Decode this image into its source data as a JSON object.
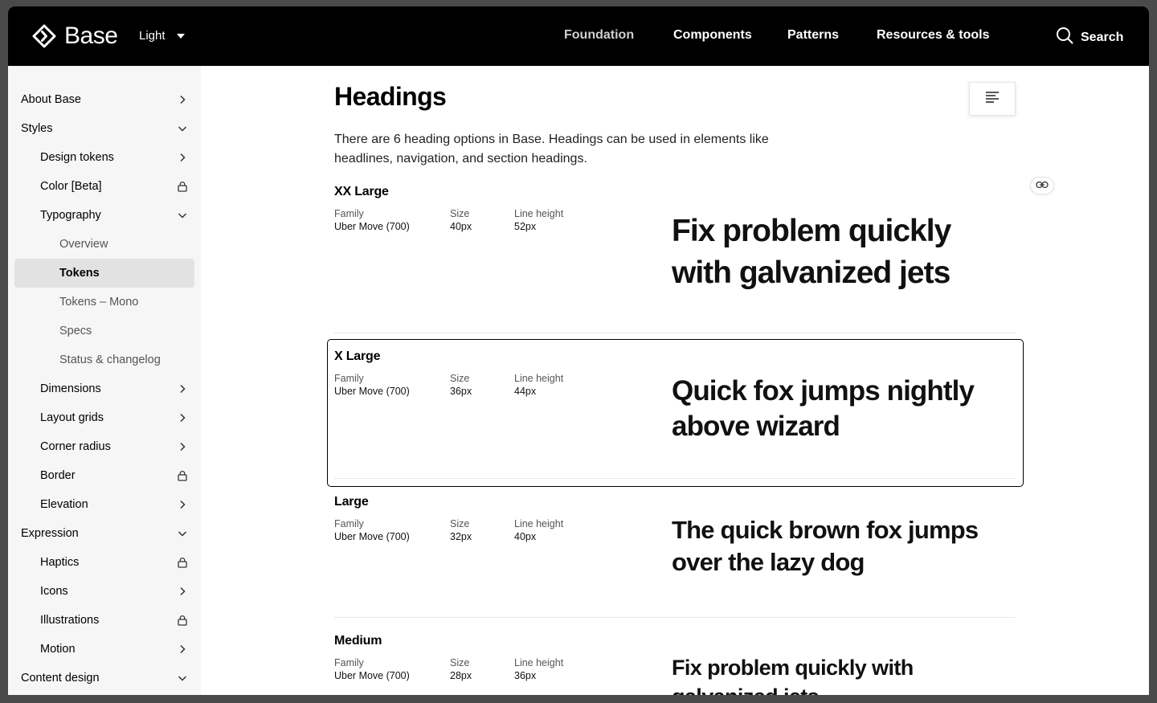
{
  "header": {
    "brand": "Base",
    "theme": "Light",
    "nav": [
      {
        "label": "Foundation",
        "active": true
      },
      {
        "label": "Components",
        "active": false
      },
      {
        "label": "Patterns",
        "active": false
      },
      {
        "label": "Resources & tools",
        "active": false
      }
    ],
    "search_label": "Search"
  },
  "sidebar": {
    "items": [
      {
        "label": "About Base",
        "icon": "chevron-right-icon"
      },
      {
        "label": "Styles",
        "icon": "chevron-down-icon"
      },
      {
        "label": "Design tokens",
        "icon": "chevron-right-icon"
      },
      {
        "label": "Color [Beta]",
        "icon": "lock-icon"
      },
      {
        "label": "Typography",
        "icon": "chevron-down-icon"
      },
      {
        "label": "Overview",
        "icon": ""
      },
      {
        "label": "Tokens",
        "icon": "",
        "selected": true
      },
      {
        "label": "Tokens – Mono",
        "icon": ""
      },
      {
        "label": "Specs",
        "icon": ""
      },
      {
        "label": "Status & changelog",
        "icon": ""
      },
      {
        "label": "Dimensions",
        "icon": "chevron-right-icon"
      },
      {
        "label": "Layout grids",
        "icon": "chevron-right-icon"
      },
      {
        "label": "Corner radius",
        "icon": "chevron-right-icon"
      },
      {
        "label": "Border",
        "icon": "lock-icon"
      },
      {
        "label": "Elevation",
        "icon": "chevron-right-icon"
      },
      {
        "label": "Expression",
        "icon": "chevron-down-icon"
      },
      {
        "label": "Haptics",
        "icon": "lock-icon"
      },
      {
        "label": "Icons",
        "icon": "chevron-right-icon"
      },
      {
        "label": "Illustrations",
        "icon": "lock-icon"
      },
      {
        "label": "Motion",
        "icon": "chevron-right-icon"
      },
      {
        "label": "Content design",
        "icon": "chevron-down-icon"
      }
    ]
  },
  "main": {
    "title": "Headings",
    "intro": "There are 6 heading options in Base. Headings can be used in elements like headlines, navigation, and section headings.",
    "meta_labels": {
      "family": "Family",
      "size": "Size",
      "line_height": "Line height"
    },
    "tokens": [
      {
        "name": "XX Large",
        "family": "Uber Move (700)",
        "size": "40px",
        "line_height": "52px",
        "sample": "Fix problem quickly with galvanized jets"
      },
      {
        "name": "X Large",
        "family": "Uber Move (700)",
        "size": "36px",
        "line_height": "44px",
        "sample": "Quick fox jumps nightly above wizard"
      },
      {
        "name": "Large",
        "family": "Uber Move (700)",
        "size": "32px",
        "line_height": "40px",
        "sample": "The quick brown fox jumps over the lazy dog"
      },
      {
        "name": "Medium",
        "family": "Uber Move (700)",
        "size": "28px",
        "line_height": "36px",
        "sample": "Fix problem quickly with galvanized jets"
      }
    ]
  }
}
